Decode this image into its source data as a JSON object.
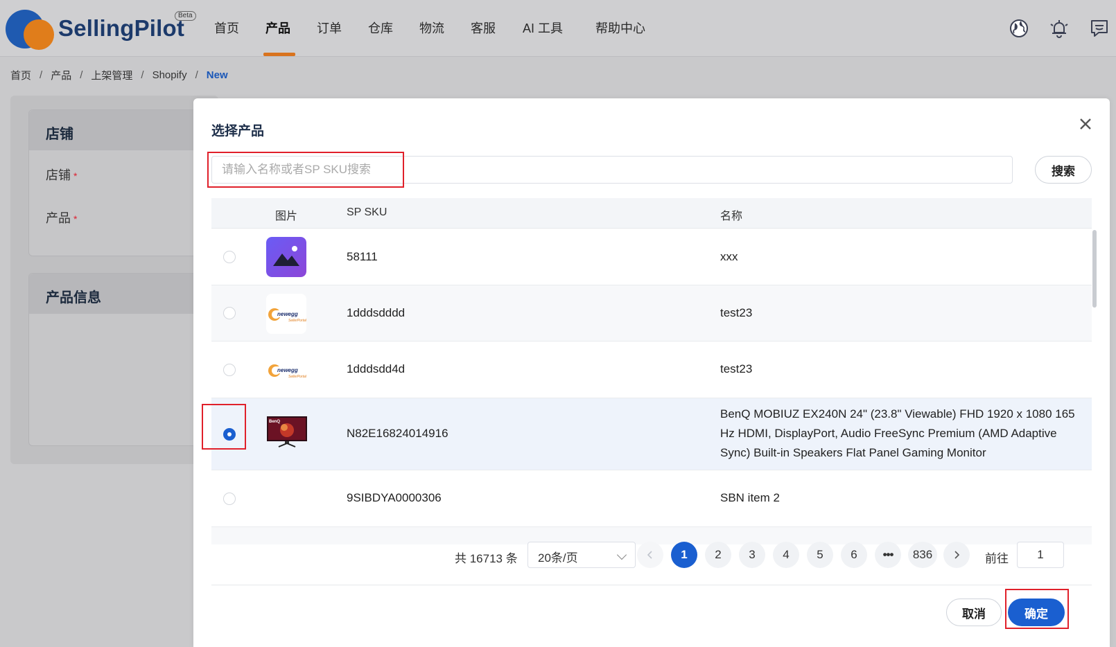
{
  "app": {
    "logo_text": "SellingPilot",
    "logo_badge": "Beta"
  },
  "nav": {
    "items": [
      {
        "label": "首页"
      },
      {
        "label": "产品"
      },
      {
        "label": "订单"
      },
      {
        "label": "仓库"
      },
      {
        "label": "物流"
      },
      {
        "label": "客服"
      },
      {
        "label": "AI 工具"
      },
      {
        "label": "帮助中心"
      }
    ],
    "active": "产品",
    "icons": [
      "globe-icon",
      "bell-icon",
      "message-icon"
    ]
  },
  "breadcrumb": {
    "items": [
      "首页",
      "产品",
      "上架管理",
      "Shopify",
      "New"
    ],
    "separator": "/"
  },
  "background_page": {
    "store_section_title": "店铺",
    "store_label": "店铺",
    "product_label": "产品",
    "required_mark": "*",
    "product_info_title": "产品信息"
  },
  "modal": {
    "title": "选择产品",
    "search": {
      "placeholder": "请输入名称或者SP SKU搜索",
      "value": "",
      "button": "搜索"
    },
    "table": {
      "headers": {
        "image": "图片",
        "sku": "SP SKU",
        "name": "名称"
      },
      "rows": [
        {
          "sku": "58111",
          "name": "xxx",
          "image": "placeholder-image-icon",
          "selected": false
        },
        {
          "sku": "1dddsdddd",
          "name": "test23",
          "image": "newegg-logo",
          "selected": false
        },
        {
          "sku": "1dddsdd4d",
          "name": "test23",
          "image": "newegg-logo",
          "selected": false
        },
        {
          "sku": "N82E16824014916",
          "name": "BenQ MOBIUZ EX240N 24\" (23.8\" Viewable) FHD 1920 x 1080 165 Hz HDMI, DisplayPort, Audio FreeSync Premium (AMD Adaptive Sync) Built-in Speakers Flat Panel Gaming Monitor",
          "image": "benq-monitor-photo",
          "selected": true
        },
        {
          "sku": "9SIBDYA0000306",
          "name": "SBN item 2",
          "image": "",
          "selected": false
        }
      ]
    },
    "pagination": {
      "total_text": "共 16713 条",
      "page_size": "20条/页",
      "pages": [
        "1",
        "2",
        "3",
        "4",
        "5",
        "6",
        "•••",
        "836"
      ],
      "current_page": "1",
      "goto_label": "前往",
      "goto_value": "1"
    },
    "footer": {
      "cancel": "取消",
      "confirm": "确定"
    }
  },
  "colors": {
    "primary": "#1a5fd0",
    "accent_orange": "#d9731e",
    "highlight_red": "#e0202a",
    "logo_blue": "#1f5ab0"
  }
}
